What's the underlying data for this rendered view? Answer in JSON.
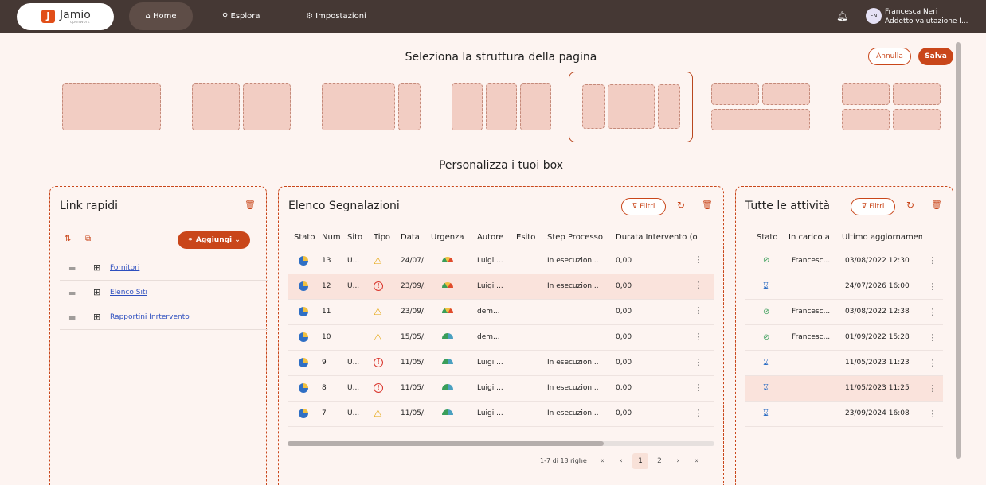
{
  "app": {
    "logo_mark": "J",
    "logo_text": "Jamio",
    "logo_sub": "openwork"
  },
  "nav": [
    {
      "label": "Home",
      "icon": "⌂"
    },
    {
      "label": "Esplora",
      "icon": "⚲"
    },
    {
      "label": "Impostazioni",
      "icon": "⚙"
    }
  ],
  "user": {
    "initials": "FN",
    "name": "Francesca Neri",
    "role": "Addetto valutazione I..."
  },
  "layout_picker": {
    "title": "Seleziona la struttura della pagina",
    "cancel": "Annulla",
    "save": "Salva"
  },
  "customize_title": "Personalizza i tuoi box",
  "quick_links": {
    "title": "Link rapidi",
    "add_label": "Aggiungi",
    "items": [
      "Fornitori",
      "Elenco Siti",
      "Rapportini Inrtervento"
    ]
  },
  "reports": {
    "title": "Elenco Segnalazioni",
    "filter": "Filtri",
    "columns": [
      "Stato",
      "Num",
      "Sito",
      "Tipo",
      "Data",
      "Urgenza",
      "Autore",
      "Esito",
      "Step Processo",
      "Durata Intervento (o"
    ],
    "rows": [
      {
        "num": "13",
        "sito": "U...",
        "tipo": "warn",
        "data": "24/07/.",
        "urg": "mid",
        "autore": "Luigi ...",
        "step": "In esecuzion...",
        "durata": "0,00"
      },
      {
        "num": "12",
        "sito": "U...",
        "tipo": "err",
        "data": "23/09/.",
        "urg": "mid",
        "autore": "Luigi ...",
        "step": "In esecuzion...",
        "durata": "0,00"
      },
      {
        "num": "11",
        "sito": "",
        "tipo": "warn",
        "data": "23/09/.",
        "urg": "mid",
        "autore": "dem...",
        "step": "",
        "durata": "0,00"
      },
      {
        "num": "10",
        "sito": "",
        "tipo": "warn",
        "data": "15/05/.",
        "urg": "low",
        "autore": "dem...",
        "step": "",
        "durata": "0,00"
      },
      {
        "num": "9",
        "sito": "U...",
        "tipo": "err",
        "data": "11/05/.",
        "urg": "low",
        "autore": "Luigi ...",
        "step": "In esecuzion...",
        "durata": "0,00"
      },
      {
        "num": "8",
        "sito": "U...",
        "tipo": "err",
        "data": "11/05/.",
        "urg": "low",
        "autore": "Luigi ...",
        "step": "In esecuzion...",
        "durata": "0,00"
      },
      {
        "num": "7",
        "sito": "U...",
        "tipo": "warn",
        "data": "11/05/.",
        "urg": "low",
        "autore": "Luigi ...",
        "step": "In esecuzion...",
        "durata": "0,00"
      }
    ],
    "pager": {
      "range": "1-7 di 13 righe",
      "pages": [
        "1",
        "2"
      ],
      "current": "1"
    }
  },
  "activities": {
    "title": "Tutte le attività",
    "filter": "Filtri",
    "columns": [
      "Stato",
      "In carico a",
      "Ultimo aggiornamento"
    ],
    "rows": [
      {
        "stato": "done",
        "carico": "Francesc...",
        "agg": "03/08/2022 12:30"
      },
      {
        "stato": "wait",
        "carico": "",
        "agg": "24/07/2026 16:00"
      },
      {
        "stato": "done",
        "carico": "Francesc...",
        "agg": "03/08/2022 12:38"
      },
      {
        "stato": "done",
        "carico": "Francesc...",
        "agg": "01/09/2022 15:28"
      },
      {
        "stato": "wait",
        "carico": "",
        "agg": "11/05/2023 11:23"
      },
      {
        "stato": "wait",
        "carico": "",
        "agg": "11/05/2023 11:25"
      },
      {
        "stato": "wait",
        "carico": "",
        "agg": "23/09/2024 16:08"
      }
    ]
  }
}
